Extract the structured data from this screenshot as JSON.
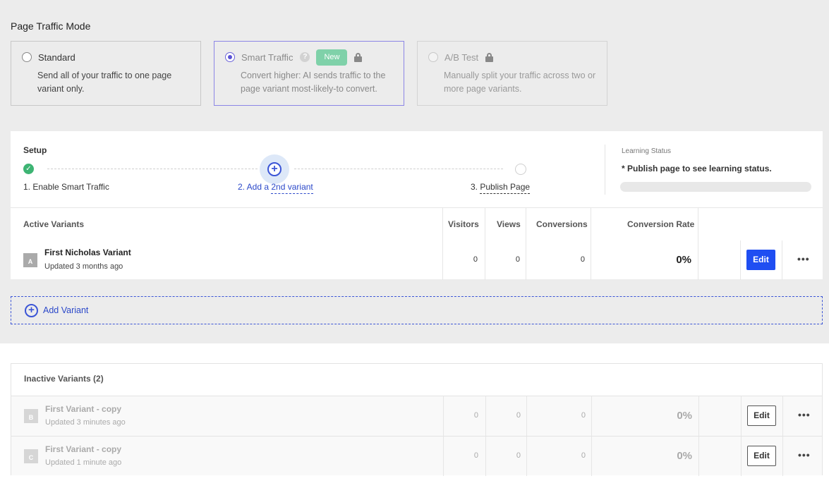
{
  "page_title": "Page Traffic Mode",
  "modes": [
    {
      "label": "Standard",
      "description": "Send all of your traffic to one page variant only."
    },
    {
      "label": "Smart Traffic",
      "badge": "New",
      "description": "Convert higher: AI sends traffic to the page variant most-likely-to convert."
    },
    {
      "label": "A/B Test",
      "description": "Manually split your traffic across two or more page variants."
    }
  ],
  "help_glyph": "?",
  "setup": {
    "label": "Setup",
    "steps": [
      {
        "label": "1. Enable Smart Traffic"
      },
      {
        "prefix": "2. Add a ",
        "link": "2nd variant"
      },
      {
        "prefix": "3. ",
        "link": "Publish Page"
      }
    ]
  },
  "learning": {
    "label": "Learning Status",
    "text": "* Publish page to see learning status."
  },
  "active": {
    "headers": {
      "title": "Active Variants",
      "visitors": "Visitors",
      "views": "Views",
      "conversions": "Conversions",
      "rate": "Conversion Rate"
    },
    "rows": [
      {
        "letter": "A",
        "name": "First Nicholas Variant",
        "updated": "Updated 3 months ago",
        "visitors": "0",
        "views": "0",
        "conversions": "0",
        "rate": "0%",
        "edit": "Edit"
      }
    ]
  },
  "add_variant_label": "Add Variant",
  "inactive": {
    "title": "Inactive Variants (2)",
    "rows": [
      {
        "letter": "B",
        "name": "First Variant - copy",
        "updated": "Updated 3 minutes ago",
        "visitors": "0",
        "views": "0",
        "conversions": "0",
        "rate": "0%",
        "edit": "Edit"
      },
      {
        "letter": "C",
        "name": "First Variant - copy",
        "updated": "Updated 1 minute ago",
        "visitors": "0",
        "views": "0",
        "conversions": "0",
        "rate": "0%",
        "edit": "Edit"
      }
    ]
  },
  "more_glyph": "•••",
  "plus_glyph": "+",
  "check_glyph": "✓",
  "colors": {
    "accent": "#1f4ef2",
    "link": "#2b48c9",
    "success": "#3db473",
    "badge": "#7fd1a9"
  }
}
